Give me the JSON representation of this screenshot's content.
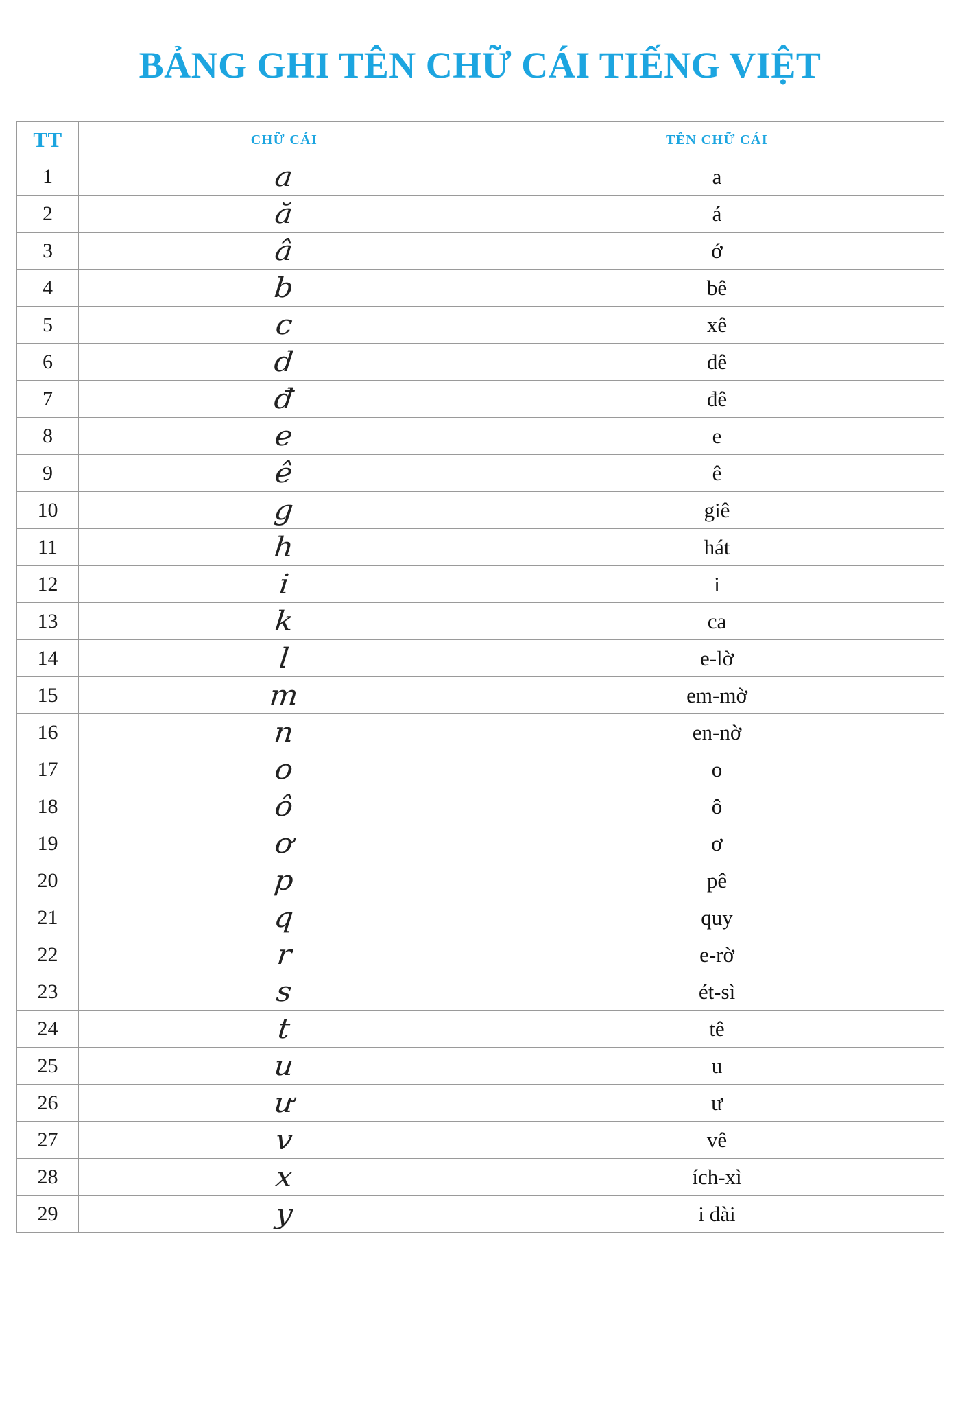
{
  "document": {
    "title": "BẢNG GHI TÊN CHỮ CÁI TIẾNG VIỆT",
    "title_color": "#1ca5e0",
    "background_color": "#ffffff",
    "border_color": "#9a9a9a"
  },
  "table": {
    "headers": {
      "index": "TT",
      "letter": "CHỮ CÁI",
      "name": "TÊN CHỮ CÁI"
    },
    "rows": [
      {
        "index": "1",
        "letter": "a",
        "name": "a"
      },
      {
        "index": "2",
        "letter": "ă",
        "name": "á"
      },
      {
        "index": "3",
        "letter": "â",
        "name": "ớ"
      },
      {
        "index": "4",
        "letter": "b",
        "name": "bê"
      },
      {
        "index": "5",
        "letter": "c",
        "name": "xê"
      },
      {
        "index": "6",
        "letter": "d",
        "name": "dê"
      },
      {
        "index": "7",
        "letter": "đ",
        "name": "đê"
      },
      {
        "index": "8",
        "letter": "e",
        "name": "e"
      },
      {
        "index": "9",
        "letter": "ê",
        "name": "ê"
      },
      {
        "index": "10",
        "letter": "g",
        "name": "giê"
      },
      {
        "index": "11",
        "letter": "h",
        "name": "hát"
      },
      {
        "index": "12",
        "letter": "i",
        "name": "i"
      },
      {
        "index": "13",
        "letter": "k",
        "name": "ca"
      },
      {
        "index": "14",
        "letter": "l",
        "name": "e-lờ"
      },
      {
        "index": "15",
        "letter": "m",
        "name": "em-mờ"
      },
      {
        "index": "16",
        "letter": "n",
        "name": "en-nờ"
      },
      {
        "index": "17",
        "letter": "o",
        "name": "o"
      },
      {
        "index": "18",
        "letter": "ô",
        "name": "ô"
      },
      {
        "index": "19",
        "letter": "ơ",
        "name": "ơ"
      },
      {
        "index": "20",
        "letter": "p",
        "name": "pê"
      },
      {
        "index": "21",
        "letter": "q",
        "name": "quy"
      },
      {
        "index": "22",
        "letter": "r",
        "name": "e-rờ"
      },
      {
        "index": "23",
        "letter": "s",
        "name": "ét-sì"
      },
      {
        "index": "24",
        "letter": "t",
        "name": "tê"
      },
      {
        "index": "25",
        "letter": "u",
        "name": "u"
      },
      {
        "index": "26",
        "letter": "ư",
        "name": "ư"
      },
      {
        "index": "27",
        "letter": "v",
        "name": "vê"
      },
      {
        "index": "28",
        "letter": "x",
        "name": "ích-xì"
      },
      {
        "index": "29",
        "letter": "y",
        "name": "i dài"
      }
    ]
  }
}
